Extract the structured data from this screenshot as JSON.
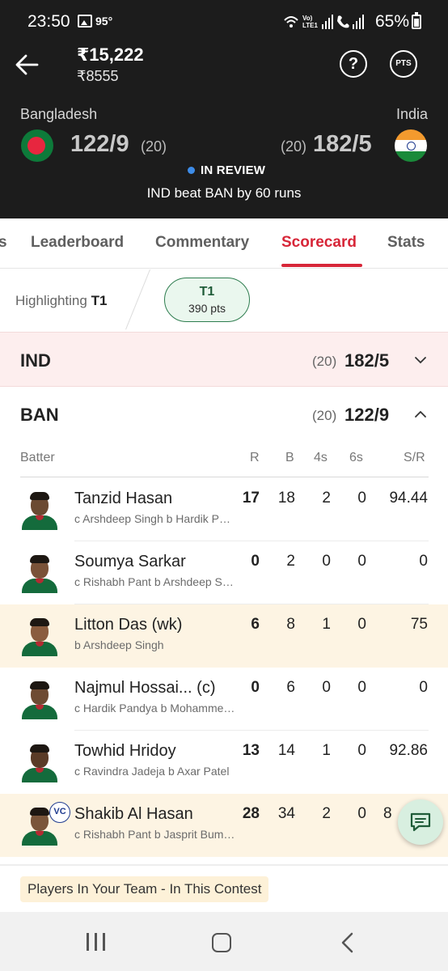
{
  "status_bar": {
    "time": "23:50",
    "temperature": "95°",
    "network_label": "Vo) LTE1",
    "battery_percent": "65%"
  },
  "header": {
    "amount_main": "₹15,222",
    "amount_sub": "₹8555",
    "pts_label": "PTS",
    "help_label": "?",
    "team_left": {
      "name": "Bangladesh",
      "score": "122/9",
      "overs": "(20)",
      "flag_icon": "bangladesh-flag-icon"
    },
    "team_right": {
      "name": "India",
      "score": "182/5",
      "overs": "(20)",
      "flag_icon": "india-flag-icon"
    },
    "status": "IN REVIEW",
    "result": "IND beat BAN by 60 runs",
    "colors": {
      "background": "#1c1c1c",
      "status_dot": "#3d8ce8"
    }
  },
  "tabs": {
    "items": [
      {
        "label": "s"
      },
      {
        "label": "Leaderboard"
      },
      {
        "label": "Commentary"
      },
      {
        "label": "Scorecard"
      },
      {
        "label": "Stats"
      }
    ],
    "active": "Scorecard",
    "accent_color": "#d72638"
  },
  "highlighting": {
    "prefix": "Highlighting",
    "team": "T1",
    "pill_team": "T1",
    "pill_points": "390 pts"
  },
  "innings": [
    {
      "team": "IND",
      "overs": "(20)",
      "score": "182/5",
      "expanded": false
    },
    {
      "team": "BAN",
      "overs": "(20)",
      "score": "122/9",
      "expanded": true
    }
  ],
  "batting_table": {
    "headers": {
      "batter": "Batter",
      "runs": "R",
      "balls": "B",
      "fours": "4s",
      "sixes": "6s",
      "strike_rate": "S/R"
    },
    "rows": [
      {
        "name": "Tanzid Hasan",
        "dismissal": "c Arshdeep Singh b Hardik Pandya",
        "runs": "17",
        "balls": "18",
        "fours": "2",
        "sixes": "0",
        "sr": "94.44",
        "highlighted": false,
        "badge": ""
      },
      {
        "name": "Soumya Sarkar",
        "dismissal": "c Rishabh Pant b Arshdeep Singh",
        "runs": "0",
        "balls": "2",
        "fours": "0",
        "sixes": "0",
        "sr": "0",
        "highlighted": false,
        "badge": ""
      },
      {
        "name": "Litton Das (wk)",
        "dismissal": "b Arshdeep Singh",
        "runs": "6",
        "balls": "8",
        "fours": "1",
        "sixes": "0",
        "sr": "75",
        "highlighted": true,
        "badge": ""
      },
      {
        "name": "Najmul Hossai... (c)",
        "dismissal": "c Hardik Pandya b Mohammed Siraj",
        "runs": "0",
        "balls": "6",
        "fours": "0",
        "sixes": "0",
        "sr": "0",
        "highlighted": false,
        "badge": ""
      },
      {
        "name": "Towhid Hridoy",
        "dismissal": "c Ravindra Jadeja b Axar Patel",
        "runs": "13",
        "balls": "14",
        "fours": "1",
        "sixes": "0",
        "sr": "92.86",
        "highlighted": false,
        "badge": ""
      },
      {
        "name": "Shakib Al Hasan",
        "dismissal": "c Rishabh Pant b Jasprit Bumrah",
        "runs": "28",
        "balls": "34",
        "fours": "2",
        "sixes": "0",
        "sr": "8",
        "highlighted": true,
        "badge": "VC"
      }
    ]
  },
  "footer": {
    "team_players_label": "Players In Your Team - In This Contest"
  }
}
